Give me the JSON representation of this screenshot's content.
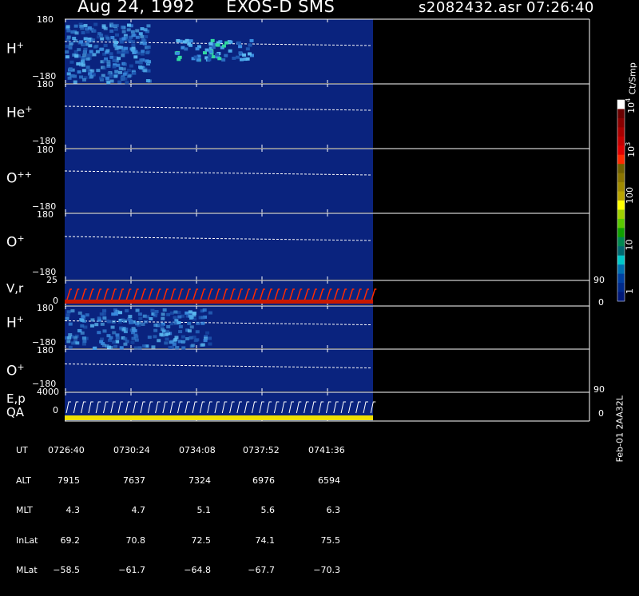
{
  "header": {
    "date": "Aug 24, 1992",
    "instrument": "EXOS-D SMS",
    "file": "s2082432.asr",
    "time": "07:26:40"
  },
  "panels": [
    {
      "label": "H",
      "sup": "+",
      "ymax": "180",
      "ymin": "−180"
    },
    {
      "label": "He",
      "sup": "+",
      "ymax": "180",
      "ymin": "−180"
    },
    {
      "label": "O",
      "sup": "++",
      "ymax": "180",
      "ymin": "−180"
    },
    {
      "label": "O",
      "sup": "+",
      "ymax": "180",
      "ymin": "−180"
    },
    {
      "label": "V,r",
      "sup": "",
      "ymax": "25",
      "ymin": "0",
      "right_max": "90",
      "right_min": "0"
    },
    {
      "label": "H",
      "sup": "+",
      "ymax": "180",
      "ymin": "−180"
    },
    {
      "label": "O",
      "sup": "+",
      "ymax": "180",
      "ymin": "−180"
    },
    {
      "label": "E,p",
      "label2": "QA",
      "sup": "",
      "ymax": "4000",
      "ymin": "0",
      "right_max": "90",
      "right_min": "0"
    }
  ],
  "colorbar": {
    "unit": "Ct/Smp",
    "ticks": [
      {
        "base": "10",
        "exp": "4",
        "pos": "t104"
      },
      {
        "base": "10",
        "exp": "3",
        "pos": "t103"
      },
      {
        "base": "100",
        "exp": "",
        "pos": "t100"
      },
      {
        "base": "10",
        "exp": "",
        "pos": "t10"
      },
      {
        "base": "1",
        "exp": "",
        "pos": "t1"
      }
    ],
    "colors": [
      "#ffffff",
      "#6a0000",
      "#8a0000",
      "#a80000",
      "#c40000",
      "#e00000",
      "#ff2a00",
      "#706000",
      "#8a7400",
      "#a08a00",
      "#b8a400",
      "#ffff00",
      "#a0d000",
      "#5ac800",
      "#10a000",
      "#008850",
      "#006870",
      "#00c8c8",
      "#0070b0",
      "#0040a0",
      "#002a8a",
      "#001878"
    ]
  },
  "bottom_label": "Feb-01 2AA32L",
  "table": {
    "rows": [
      {
        "name": "UT",
        "values": [
          "0726:40",
          "0730:24",
          "0734:08",
          "0737:52",
          "0741:36"
        ]
      },
      {
        "name": "ALT",
        "values": [
          "7915",
          "7637",
          "7324",
          "6976",
          "6594"
        ]
      },
      {
        "name": "MLT",
        "values": [
          "4.3",
          "4.7",
          "5.1",
          "5.6",
          "6.3"
        ]
      },
      {
        "name": "InLat",
        "values": [
          "69.2",
          "70.8",
          "72.5",
          "74.1",
          "75.5"
        ]
      },
      {
        "name": "MLat",
        "values": [
          "−58.5",
          "−61.7",
          "−64.8",
          "−67.7",
          "−70.3"
        ]
      }
    ]
  },
  "chart_data": {
    "type": "heatmap",
    "title": "Aug 24, 1992   EXOS-D SMS",
    "x_ticks": [
      "0726:40",
      "0730:24",
      "0734:08",
      "0737:52",
      "0741:36"
    ],
    "ylim": [
      -180,
      180
    ],
    "panels": [
      "H+",
      "He+",
      "O++",
      "O+",
      "V,r",
      "H+",
      "O+",
      "E,p QA"
    ],
    "color_scale": "log",
    "color_unit": "Ct/Smp",
    "color_range": [
      1,
      10000
    ]
  }
}
